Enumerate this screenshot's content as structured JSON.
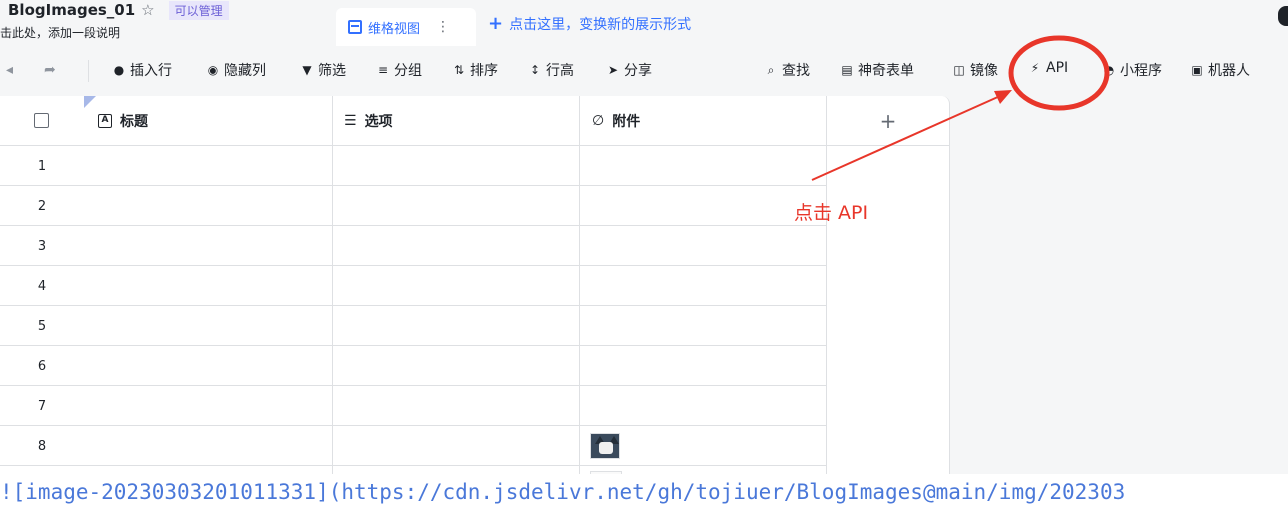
{
  "header": {
    "title": "BlogImages_01",
    "permission_badge": "可以管理",
    "description": "击此处，添加一段说明",
    "active_tab": "维格视图",
    "add_view": "点击这里，变换新的展示形式"
  },
  "toolbar": {
    "back_icon": "arrow-left-icon",
    "forward_icon": "arrow-right-icon",
    "insert_row": "插入行",
    "hide_columns": "隐藏列",
    "filter": "筛选",
    "group": "分组",
    "sort": "排序",
    "row_height": "行高",
    "share": "分享",
    "search": "查找",
    "magic_form": "神奇表单",
    "mirror": "镜像",
    "api": "API",
    "mini_program": "小程序",
    "robot": "机器人"
  },
  "grid": {
    "columns": [
      {
        "label": "标题",
        "icon": "text-field-icon"
      },
      {
        "label": "选项",
        "icon": "options-icon"
      },
      {
        "label": "附件",
        "icon": "paperclip-icon"
      }
    ],
    "add_column": "+",
    "rows": [
      "1",
      "2",
      "3",
      "4",
      "5",
      "6",
      "7",
      "8"
    ]
  },
  "annotation": {
    "text": "点击 API",
    "color": "#e8362a"
  },
  "footer_code": "![image-20230303201011331](https://cdn.jsdelivr.net/gh/tojiuer/BlogImages@main/img/202303"
}
